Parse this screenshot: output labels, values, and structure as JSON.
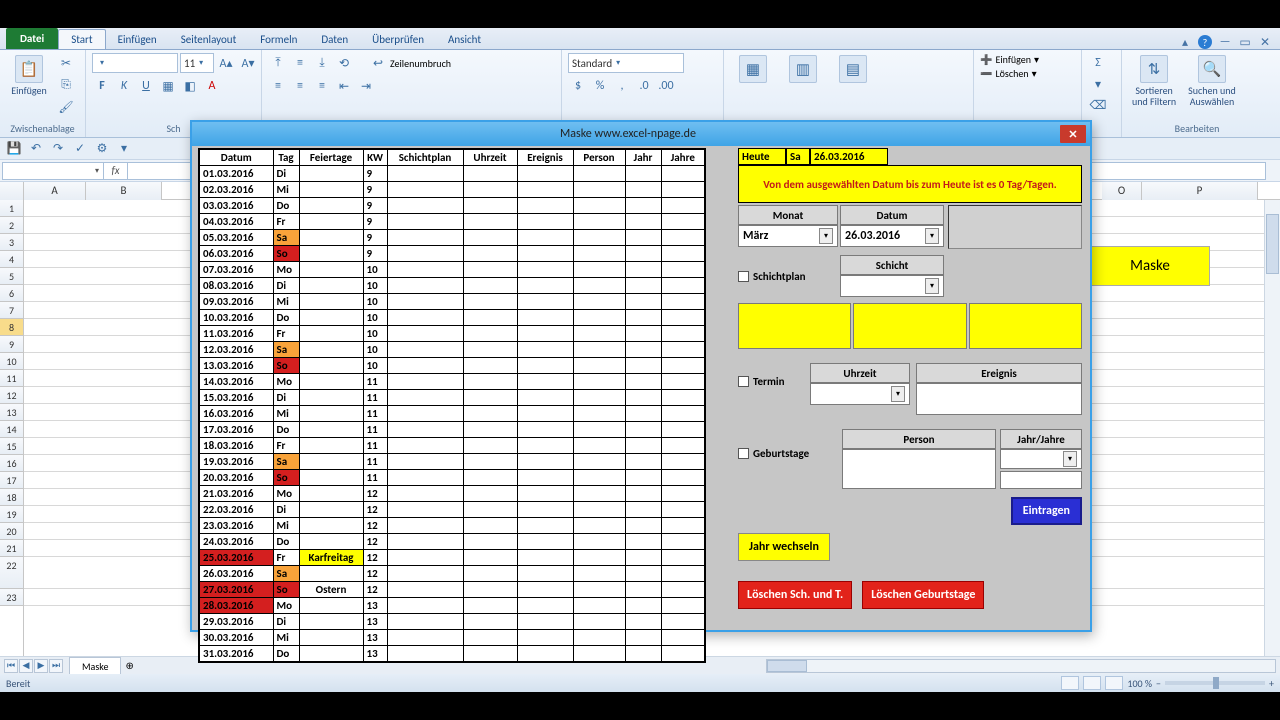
{
  "tabs": {
    "file": "Datei",
    "home": "Start",
    "insert": "Einfügen",
    "layout": "Seitenlayout",
    "formulas": "Formeln",
    "data": "Daten",
    "review": "Überprüfen",
    "view": "Ansicht"
  },
  "ribbon": {
    "clipboard": {
      "paste": "Einfügen",
      "label": "Zwischenablage"
    },
    "font": {
      "size": "11",
      "label": "Sch"
    },
    "align": {
      "wrap": "Zeilenumbruch"
    },
    "number": {
      "format": "Standard"
    },
    "cells": {
      "insert": "Einfügen",
      "delete": "Löschen"
    },
    "editing": {
      "sort": "Sortieren\nund Filtern",
      "find": "Suchen und\nAuswählen",
      "label": "Bearbeiten"
    }
  },
  "sheet_btn": "Maske",
  "cols": [
    "A",
    "B",
    "O",
    "P"
  ],
  "dialog": {
    "title": "Maske www.excel-npage.de",
    "headers": [
      "Datum",
      "Tag",
      "Feiertage",
      "KW",
      "Schichtplan",
      "Uhrzeit",
      "Ereignis",
      "Person",
      "Jahr",
      "Jahre"
    ],
    "rows": [
      {
        "d": "01.03.2016",
        "t": "Di",
        "f": "",
        "kw": "9"
      },
      {
        "d": "02.03.2016",
        "t": "Mi",
        "f": "",
        "kw": "9"
      },
      {
        "d": "03.03.2016",
        "t": "Do",
        "f": "",
        "kw": "9"
      },
      {
        "d": "04.03.2016",
        "t": "Fr",
        "f": "",
        "kw": "9"
      },
      {
        "d": "05.03.2016",
        "t": "Sa",
        "f": "",
        "kw": "9",
        "tcls": "bg-or"
      },
      {
        "d": "06.03.2016",
        "t": "So",
        "f": "",
        "kw": "9",
        "tcls": "bg-rd"
      },
      {
        "d": "07.03.2016",
        "t": "Mo",
        "f": "",
        "kw": "10"
      },
      {
        "d": "08.03.2016",
        "t": "Di",
        "f": "",
        "kw": "10"
      },
      {
        "d": "09.03.2016",
        "t": "Mi",
        "f": "",
        "kw": "10"
      },
      {
        "d": "10.03.2016",
        "t": "Do",
        "f": "",
        "kw": "10"
      },
      {
        "d": "11.03.2016",
        "t": "Fr",
        "f": "",
        "kw": "10"
      },
      {
        "d": "12.03.2016",
        "t": "Sa",
        "f": "",
        "kw": "10",
        "tcls": "bg-or"
      },
      {
        "d": "13.03.2016",
        "t": "So",
        "f": "",
        "kw": "10",
        "tcls": "bg-rd"
      },
      {
        "d": "14.03.2016",
        "t": "Mo",
        "f": "",
        "kw": "11"
      },
      {
        "d": "15.03.2016",
        "t": "Di",
        "f": "",
        "kw": "11"
      },
      {
        "d": "16.03.2016",
        "t": "Mi",
        "f": "",
        "kw": "11"
      },
      {
        "d": "17.03.2016",
        "t": "Do",
        "f": "",
        "kw": "11"
      },
      {
        "d": "18.03.2016",
        "t": "Fr",
        "f": "",
        "kw": "11"
      },
      {
        "d": "19.03.2016",
        "t": "Sa",
        "f": "",
        "kw": "11",
        "tcls": "bg-or"
      },
      {
        "d": "20.03.2016",
        "t": "So",
        "f": "",
        "kw": "11",
        "tcls": "bg-rd"
      },
      {
        "d": "21.03.2016",
        "t": "Mo",
        "f": "",
        "kw": "12"
      },
      {
        "d": "22.03.2016",
        "t": "Di",
        "f": "",
        "kw": "12"
      },
      {
        "d": "23.03.2016",
        "t": "Mi",
        "f": "",
        "kw": "12"
      },
      {
        "d": "24.03.2016",
        "t": "Do",
        "f": "",
        "kw": "12"
      },
      {
        "d": "25.03.2016",
        "t": "Fr",
        "f": "Karfreitag",
        "kw": "12",
        "dcls": "bg-rd",
        "fcls": "bg-ye"
      },
      {
        "d": "26.03.2016",
        "t": "Sa",
        "f": "",
        "kw": "12",
        "tcls": "bg-or"
      },
      {
        "d": "27.03.2016",
        "t": "So",
        "f": "Ostern",
        "kw": "12",
        "dcls": "bg-rd",
        "tcls": "bg-rd"
      },
      {
        "d": "28.03.2016",
        "t": "Mo",
        "f": "",
        "kw": "13",
        "dcls": "bg-rd"
      },
      {
        "d": "29.03.2016",
        "t": "Di",
        "f": "",
        "kw": "13"
      },
      {
        "d": "30.03.2016",
        "t": "Mi",
        "f": "",
        "kw": "13"
      },
      {
        "d": "31.03.2016",
        "t": "Do",
        "f": "",
        "kw": "13"
      }
    ],
    "heute": {
      "lbl": "Heute",
      "tag": "Sa",
      "date": "26.03.2016"
    },
    "msg": "Von dem ausgewählten Datum bis zum Heute ist es 0 Tag/Tagen.",
    "monat_lbl": "Monat",
    "monat_val": "März",
    "datum_lbl": "Datum",
    "datum_val": "26.03.2016",
    "schicht_lbl": "Schicht",
    "schichtplan_chk": "Schichtplan",
    "termin_chk": "Termin",
    "uhrzeit_lbl": "Uhrzeit",
    "ereignis_lbl": "Ereignis",
    "geb_chk": "Geburtstage",
    "person_lbl": "Person",
    "jahr_lbl": "Jahr/Jahre",
    "btn_eintragen": "Eintragen",
    "btn_jahr": "Jahr wechseln",
    "btn_del1": "Löschen Sch. und T.",
    "btn_del2": "Löschen Geburtstage"
  },
  "link": "www.excel-.npage.de",
  "sheet_tab": "Maske",
  "status": "Bereit",
  "zoom": "100 %"
}
